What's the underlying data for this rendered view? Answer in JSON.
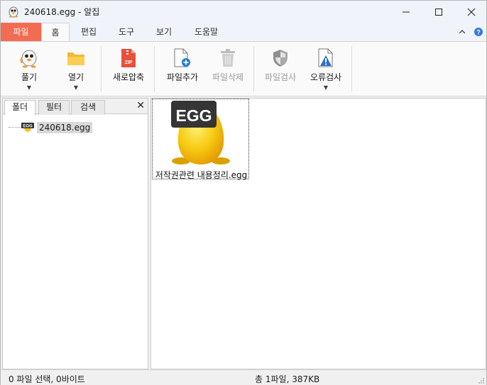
{
  "window": {
    "title": "240618.egg - 알집",
    "controls": [
      "minimize",
      "maximize",
      "close"
    ]
  },
  "menu_tabs": {
    "file": "파일",
    "home": "홈",
    "edit": "편집",
    "tools": "도구",
    "view": "보기",
    "help": "도움말",
    "active": "홈"
  },
  "ribbon": {
    "unzip": "풀기",
    "open": "열기",
    "new_zip": "새로압축",
    "add_file": "파일추가",
    "delete_file": "파일삭제",
    "scan_file": "파일검사",
    "error_check": "오류검사",
    "zip_badge": "ZIP"
  },
  "left_panel": {
    "tabs": [
      "폴더",
      "필터",
      "검색"
    ],
    "active_tab": "폴더",
    "close_symbol": "✕",
    "tree_icon_label": "EGG",
    "tree_item": "240618.egg"
  },
  "main_panel": {
    "file_icon_label": "EGG",
    "file_name": "저작권관련 내용정리.egg"
  },
  "status": {
    "left": "0 파일 선택,  0바이트",
    "right": "총 1파일,  387KB"
  },
  "colors": {
    "file_tab": "#f26c52",
    "egg_yellow": "#f5c518",
    "egg_badge": "#333333"
  }
}
